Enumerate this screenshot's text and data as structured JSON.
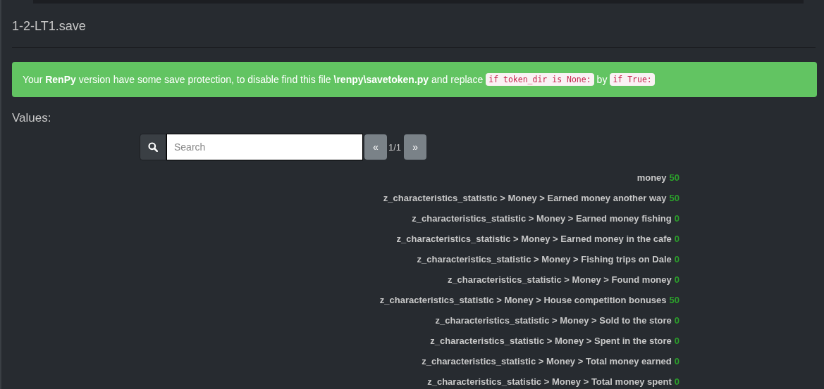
{
  "title": "1-2-LT1.save",
  "alert": {
    "parts": [
      {
        "kind": "text",
        "text": "Your **RenPy** version have some save protection, to disable find this file **\\renpy\\savetoken.py** and replace"
      },
      {
        "kind": "code",
        "text": "if token_dir is None:"
      },
      {
        "kind": "text",
        "text": "by"
      },
      {
        "kind": "code",
        "text": "if True:"
      }
    ]
  },
  "values_label": "Values:",
  "search": {
    "placeholder": "Search"
  },
  "pager": {
    "prev": "«",
    "page": "1/1",
    "next": "»"
  },
  "rows": [
    {
      "name": "money",
      "value": "50"
    },
    {
      "name": "z_characteristics_statistic > Money > Earned money another way",
      "value": "50"
    },
    {
      "name": "z_characteristics_statistic > Money > Earned money fishing",
      "value": "0"
    },
    {
      "name": "z_characteristics_statistic > Money > Earned money in the cafe",
      "value": "0"
    },
    {
      "name": "z_characteristics_statistic > Money > Fishing trips on Dale",
      "value": "0"
    },
    {
      "name": "z_characteristics_statistic > Money > Found money",
      "value": "0"
    },
    {
      "name": "z_characteristics_statistic > Money > House competition bonuses",
      "value": "50"
    },
    {
      "name": "z_characteristics_statistic > Money > Sold to the store",
      "value": "0"
    },
    {
      "name": "z_characteristics_statistic > Money > Spent in the store",
      "value": "0"
    },
    {
      "name": "z_characteristics_statistic > Money > Total money earned",
      "value": "0"
    },
    {
      "name": "z_characteristics_statistic > Money > Total money spent",
      "value": "0"
    }
  ]
}
